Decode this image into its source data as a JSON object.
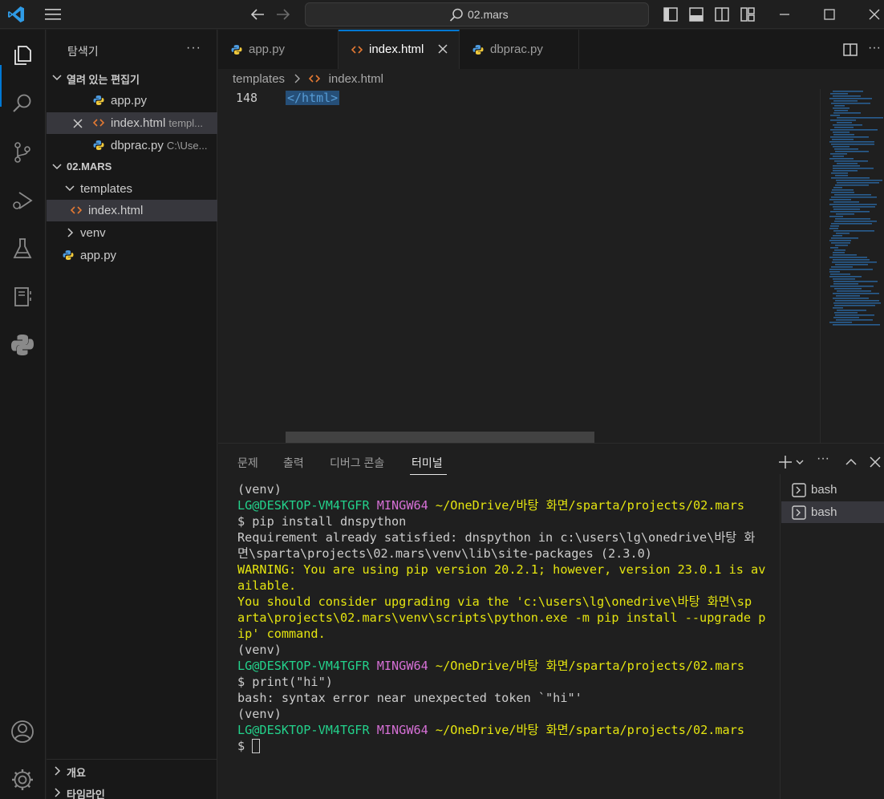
{
  "titlebar": {
    "search_text": "02.mars"
  },
  "sidebar": {
    "title": "탐색기",
    "more": "···",
    "open_editors": {
      "label": "열려 있는 편집기",
      "items": [
        {
          "name": "app.py",
          "desc": ""
        },
        {
          "name": "index.html",
          "desc": "templ..."
        },
        {
          "name": "dbprac.py",
          "desc": "C:\\Use..."
        }
      ]
    },
    "workspace": {
      "label": "02.MARS",
      "items": [
        {
          "name": "templates"
        },
        {
          "name": "index.html"
        },
        {
          "name": "venv"
        },
        {
          "name": "app.py"
        }
      ]
    },
    "outline_label": "개요",
    "timeline_label": "타임라인"
  },
  "editor": {
    "tabs": [
      {
        "label": "app.py"
      },
      {
        "label": "index.html"
      },
      {
        "label": "dbprac.py"
      }
    ],
    "breadcrumb": [
      "templates",
      "index.html"
    ],
    "line_number": "148",
    "line_text": "</html>"
  },
  "panel": {
    "tabs": [
      "문제",
      "출력",
      "디버그 콘솔",
      "터미널"
    ],
    "terminal_lines": {
      "l1": "(venv)",
      "user": "LG@DESKTOP-VM4TGFR",
      "env": "MINGW64",
      "path": "~/OneDrive/바탕 화면/sparta/projects/02.mars",
      "cmd1": "$ pip install dnspython",
      "out1a": "Requirement already satisfied: dnspython in c:\\users\\lg\\onedrive\\바탕 화",
      "out1b": "면\\sparta\\projects\\02.mars\\venv\\lib\\site-packages (2.3.0)",
      "warn1": "WARNING: You are using pip version 20.2.1; however, version 23.0.1 is av",
      "warn2": "ailable.",
      "warn3": "You should consider upgrading via the 'c:\\users\\lg\\onedrive\\바탕 화면\\sp",
      "warn4": "arta\\projects\\02.mars\\venv\\scripts\\python.exe -m pip install --upgrade p",
      "warn5": "ip' command.",
      "cmd2": "$ print(\"hi\")",
      "err": "bash: syntax error near unexpected token `\"hi\"'",
      "prompt": "$ "
    },
    "terminals": [
      "bash",
      "bash"
    ]
  }
}
